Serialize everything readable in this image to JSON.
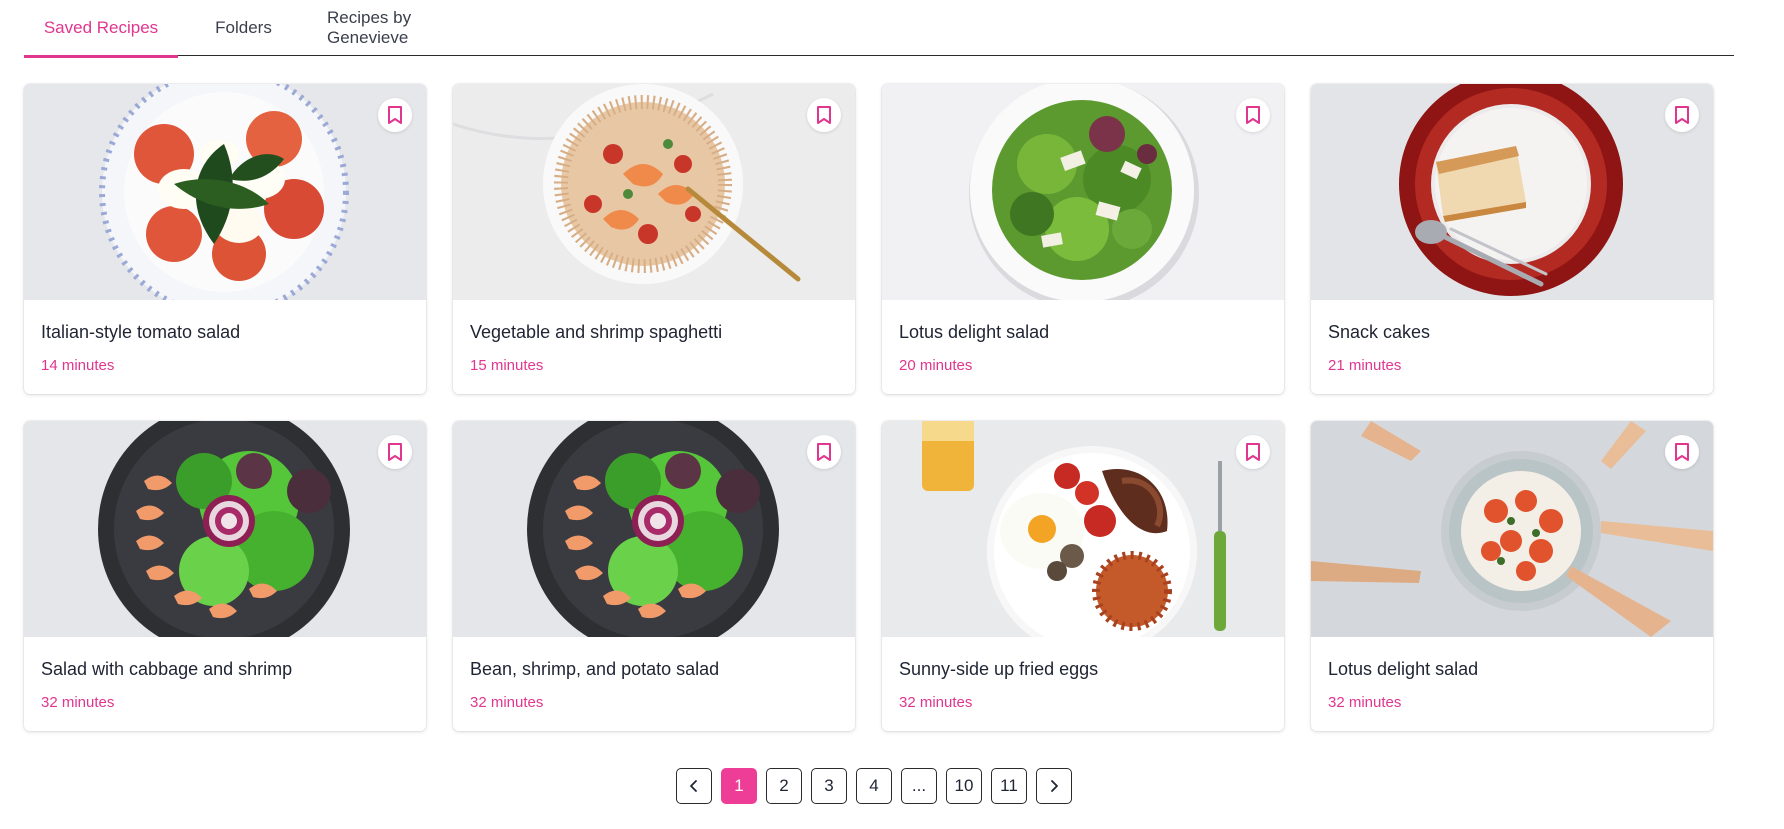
{
  "tabs": [
    {
      "label": "Saved Recipes",
      "active": true
    },
    {
      "label": "Folders",
      "active": false
    },
    {
      "label": "Recipes by Genevieve",
      "active": false
    }
  ],
  "recipes": [
    {
      "title": "Italian-style tomato salad",
      "time": "14 minutes",
      "image": "caprese-salad-photo"
    },
    {
      "title": "Vegetable and shrimp spaghetti",
      "time": "15 minutes",
      "image": "shrimp-spaghetti-photo"
    },
    {
      "title": "Lotus delight salad",
      "time": "20 minutes",
      "image": "green-salad-photo"
    },
    {
      "title": "Snack cakes",
      "time": "21 minutes",
      "image": "cake-slice-photo"
    },
    {
      "title": "Salad with cabbage and shrimp",
      "time": "32 minutes",
      "image": "shrimp-salad-bowl-photo"
    },
    {
      "title": "Bean, shrimp, and potato salad",
      "time": "32 minutes",
      "image": "shrimp-salad-bowl-photo"
    },
    {
      "title": "Sunny-side up fried eggs",
      "time": "32 minutes",
      "image": "breakfast-plate-photo"
    },
    {
      "title": "Lotus delight salad",
      "time": "32 minutes",
      "image": "shared-platter-photo"
    }
  ],
  "pagination": {
    "prev_icon": "chevron-left-icon",
    "next_icon": "chevron-right-icon",
    "pages": [
      "1",
      "2",
      "3",
      "4",
      "...",
      "10",
      "11"
    ],
    "current": "1"
  },
  "colors": {
    "accent": "#e0368f",
    "active_page": "#ee3d96"
  }
}
